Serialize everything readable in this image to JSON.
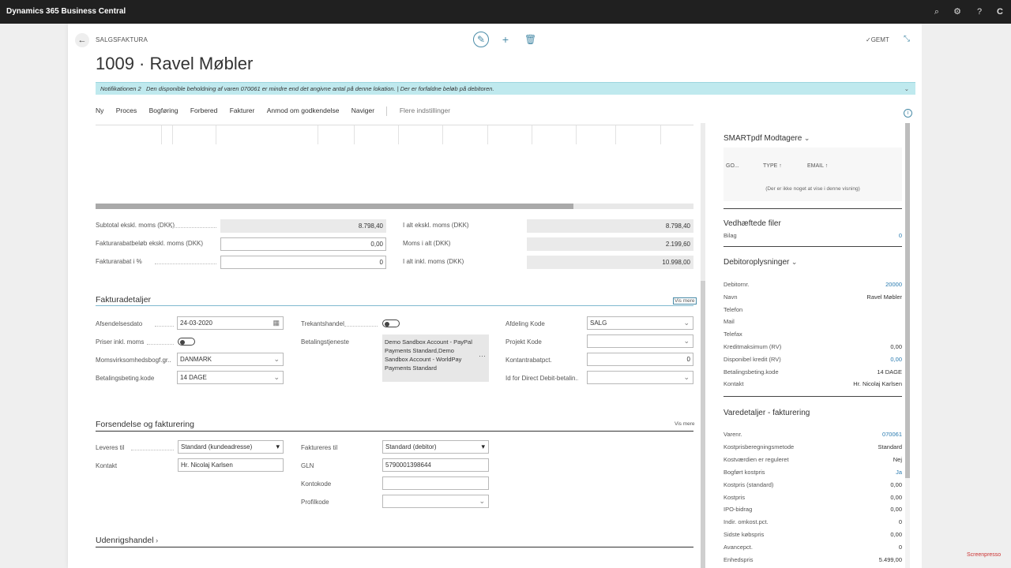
{
  "app": {
    "title": "Dynamics 365 Business Central",
    "user_initial": "C"
  },
  "header": {
    "caption": "SALGSFAKTURA",
    "title": "1009 · Ravel Møbler",
    "saved": "✓GEMT"
  },
  "notification": {
    "count_label": "Notifikationen 2",
    "text": "Den disponible beholdning af varen 070061 er mindre end det angivne antal på denne lokation. | Der er forfaldne beløb på debitoren."
  },
  "actions": [
    "Ny",
    "Proces",
    "Bogføring",
    "Forbered",
    "Fakturer",
    "Anmod om godkendelse",
    "Naviger",
    "Flere indstillinger"
  ],
  "totals": {
    "subtotal_label": "Subtotal ekskl. moms (DKK)",
    "subtotal_value": "8.798,40",
    "discount_amount_label": "Fakturarabatbeløb ekskl. moms (DKK)",
    "discount_amount_value": "0,00",
    "discount_pct_label": "Fakturarabat i %",
    "discount_pct_value": "0",
    "total_excl_label": "I alt ekskl. moms (DKK)",
    "total_excl_value": "8.798,40",
    "vat_label": "Moms i alt (DKK)",
    "vat_value": "2.199,60",
    "total_incl_label": "I alt inkl. moms (DKK)",
    "total_incl_value": "10.998,00"
  },
  "invoice_details": {
    "title": "Fakturadetaljer",
    "show_more": "Vis mere",
    "shipment_date_label": "Afsendelsesdato",
    "shipment_date": "24-03-2020",
    "prices_incl_vat_label": "Priser inkl. moms",
    "vat_bus_posting_label": "Momsvirksomhedsbogf.gr...",
    "vat_bus_posting": "DANMARK",
    "payment_terms_label": "Betalingsbeting.kode",
    "payment_terms": "14 DAGE",
    "triangulation_label": "Trekantshandel",
    "payment_service_label": "Betalingstjeneste",
    "payment_service": "Demo Sandbox Account - PayPal Payments Standard,Demo Sandbox Account - WorldPay Payments Standard",
    "department_label": "Afdeling Kode",
    "department": "SALG",
    "project_label": "Projekt Kode",
    "project": "",
    "cash_discount_label": "Kontantrabatpct.",
    "cash_discount": "0",
    "direct_debit_label": "Id for Direct Debit-betalin...",
    "direct_debit": ""
  },
  "shipping": {
    "title": "Forsendelse og fakturering",
    "show_more": "Vis mere",
    "ship_to_label": "Leveres til",
    "ship_to": "Standard (kundeadresse)",
    "contact_label": "Kontakt",
    "contact": "Hr. Nicolaj Karlsen",
    "bill_to_label": "Faktureres til",
    "bill_to": "Standard (debitor)",
    "gln_label": "GLN",
    "gln": "5790001398644",
    "account_code_label": "Kontokode",
    "account_code": "",
    "profile_code_label": "Profilkode",
    "profile_code": ""
  },
  "foreign_trade": {
    "title": "Udenrigshandel"
  },
  "factbox": {
    "smartpdf_title": "SMARTpdf Modtagere",
    "smartpdf_cols": [
      "GO...",
      "TYPE ↑",
      "EMAIL ↑"
    ],
    "smartpdf_empty": "(Der er ikke noget at vise i denne visning)",
    "attachments_title": "Vedhæftede filer",
    "attachments_label": "Bilag",
    "attachments_value": "0",
    "customer_title": "Debitoroplysninger",
    "customer_rows": [
      {
        "label": "Debitornr.",
        "value": "20000",
        "link": true
      },
      {
        "label": "Navn",
        "value": "Ravel Møbler",
        "link": false
      },
      {
        "label": "Telefon",
        "value": "",
        "link": false
      },
      {
        "label": "Mail",
        "value": "",
        "link": false
      },
      {
        "label": "Telefax",
        "value": "",
        "link": false
      },
      {
        "label": "Kreditmaksimum (RV)",
        "value": "0,00",
        "link": false
      },
      {
        "label": "Disponibel kredit (RV)",
        "value": "0,00",
        "link": true
      },
      {
        "label": "Betalingsbeting.kode",
        "value": "14 DAGE",
        "link": false
      },
      {
        "label": "Kontakt",
        "value": "Hr. Nicolaj Karlsen",
        "link": false
      }
    ],
    "item_title": "Varedetaljer - fakturering",
    "item_rows": [
      {
        "label": "Varenr.",
        "value": "070061",
        "link": true
      },
      {
        "label": "Kostprisberegningsmetode",
        "value": "Standard",
        "link": false
      },
      {
        "label": "Kostværdien er reguleret",
        "value": "Nej",
        "link": false
      },
      {
        "label": "Bogført kostpris",
        "value": "Ja",
        "link": true
      },
      {
        "label": "Kostpris (standard)",
        "value": "0,00",
        "link": false
      },
      {
        "label": "Kostpris",
        "value": "0,00",
        "link": false
      },
      {
        "label": "IPO-bidrag",
        "value": "0,00",
        "link": false
      },
      {
        "label": "Indir. omkost.pct.",
        "value": "0",
        "link": false
      },
      {
        "label": "Sidste købspris",
        "value": "0,00",
        "link": false
      },
      {
        "label": "Avancepct.",
        "value": "0",
        "link": false
      },
      {
        "label": "Enhedspris",
        "value": "5.499,00",
        "link": false
      }
    ]
  },
  "watermark": "Screenpresso"
}
